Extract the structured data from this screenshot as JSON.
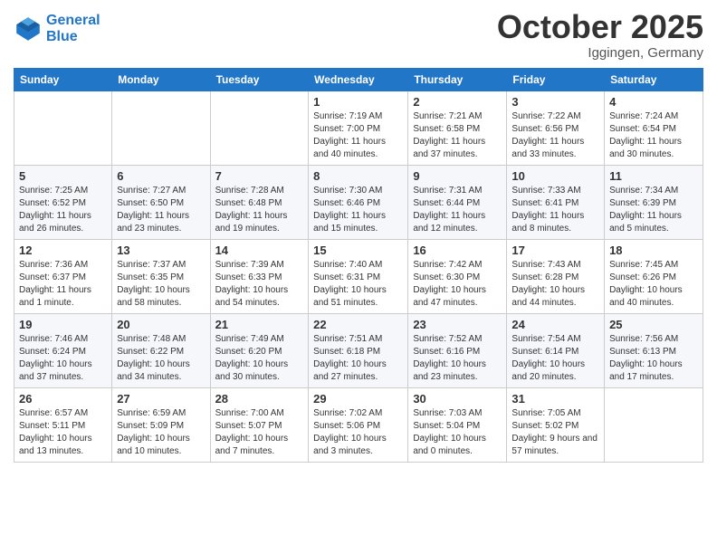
{
  "header": {
    "logo_line1": "General",
    "logo_line2": "Blue",
    "month": "October 2025",
    "location": "Iggingen, Germany"
  },
  "weekdays": [
    "Sunday",
    "Monday",
    "Tuesday",
    "Wednesday",
    "Thursday",
    "Friday",
    "Saturday"
  ],
  "weeks": [
    [
      {
        "day": "",
        "info": ""
      },
      {
        "day": "",
        "info": ""
      },
      {
        "day": "",
        "info": ""
      },
      {
        "day": "1",
        "info": "Sunrise: 7:19 AM\nSunset: 7:00 PM\nDaylight: 11 hours and 40 minutes."
      },
      {
        "day": "2",
        "info": "Sunrise: 7:21 AM\nSunset: 6:58 PM\nDaylight: 11 hours and 37 minutes."
      },
      {
        "day": "3",
        "info": "Sunrise: 7:22 AM\nSunset: 6:56 PM\nDaylight: 11 hours and 33 minutes."
      },
      {
        "day": "4",
        "info": "Sunrise: 7:24 AM\nSunset: 6:54 PM\nDaylight: 11 hours and 30 minutes."
      }
    ],
    [
      {
        "day": "5",
        "info": "Sunrise: 7:25 AM\nSunset: 6:52 PM\nDaylight: 11 hours and 26 minutes."
      },
      {
        "day": "6",
        "info": "Sunrise: 7:27 AM\nSunset: 6:50 PM\nDaylight: 11 hours and 23 minutes."
      },
      {
        "day": "7",
        "info": "Sunrise: 7:28 AM\nSunset: 6:48 PM\nDaylight: 11 hours and 19 minutes."
      },
      {
        "day": "8",
        "info": "Sunrise: 7:30 AM\nSunset: 6:46 PM\nDaylight: 11 hours and 15 minutes."
      },
      {
        "day": "9",
        "info": "Sunrise: 7:31 AM\nSunset: 6:44 PM\nDaylight: 11 hours and 12 minutes."
      },
      {
        "day": "10",
        "info": "Sunrise: 7:33 AM\nSunset: 6:41 PM\nDaylight: 11 hours and 8 minutes."
      },
      {
        "day": "11",
        "info": "Sunrise: 7:34 AM\nSunset: 6:39 PM\nDaylight: 11 hours and 5 minutes."
      }
    ],
    [
      {
        "day": "12",
        "info": "Sunrise: 7:36 AM\nSunset: 6:37 PM\nDaylight: 11 hours and 1 minute."
      },
      {
        "day": "13",
        "info": "Sunrise: 7:37 AM\nSunset: 6:35 PM\nDaylight: 10 hours and 58 minutes."
      },
      {
        "day": "14",
        "info": "Sunrise: 7:39 AM\nSunset: 6:33 PM\nDaylight: 10 hours and 54 minutes."
      },
      {
        "day": "15",
        "info": "Sunrise: 7:40 AM\nSunset: 6:31 PM\nDaylight: 10 hours and 51 minutes."
      },
      {
        "day": "16",
        "info": "Sunrise: 7:42 AM\nSunset: 6:30 PM\nDaylight: 10 hours and 47 minutes."
      },
      {
        "day": "17",
        "info": "Sunrise: 7:43 AM\nSunset: 6:28 PM\nDaylight: 10 hours and 44 minutes."
      },
      {
        "day": "18",
        "info": "Sunrise: 7:45 AM\nSunset: 6:26 PM\nDaylight: 10 hours and 40 minutes."
      }
    ],
    [
      {
        "day": "19",
        "info": "Sunrise: 7:46 AM\nSunset: 6:24 PM\nDaylight: 10 hours and 37 minutes."
      },
      {
        "day": "20",
        "info": "Sunrise: 7:48 AM\nSunset: 6:22 PM\nDaylight: 10 hours and 34 minutes."
      },
      {
        "day": "21",
        "info": "Sunrise: 7:49 AM\nSunset: 6:20 PM\nDaylight: 10 hours and 30 minutes."
      },
      {
        "day": "22",
        "info": "Sunrise: 7:51 AM\nSunset: 6:18 PM\nDaylight: 10 hours and 27 minutes."
      },
      {
        "day": "23",
        "info": "Sunrise: 7:52 AM\nSunset: 6:16 PM\nDaylight: 10 hours and 23 minutes."
      },
      {
        "day": "24",
        "info": "Sunrise: 7:54 AM\nSunset: 6:14 PM\nDaylight: 10 hours and 20 minutes."
      },
      {
        "day": "25",
        "info": "Sunrise: 7:56 AM\nSunset: 6:13 PM\nDaylight: 10 hours and 17 minutes."
      }
    ],
    [
      {
        "day": "26",
        "info": "Sunrise: 6:57 AM\nSunset: 5:11 PM\nDaylight: 10 hours and 13 minutes."
      },
      {
        "day": "27",
        "info": "Sunrise: 6:59 AM\nSunset: 5:09 PM\nDaylight: 10 hours and 10 minutes."
      },
      {
        "day": "28",
        "info": "Sunrise: 7:00 AM\nSunset: 5:07 PM\nDaylight: 10 hours and 7 minutes."
      },
      {
        "day": "29",
        "info": "Sunrise: 7:02 AM\nSunset: 5:06 PM\nDaylight: 10 hours and 3 minutes."
      },
      {
        "day": "30",
        "info": "Sunrise: 7:03 AM\nSunset: 5:04 PM\nDaylight: 10 hours and 0 minutes."
      },
      {
        "day": "31",
        "info": "Sunrise: 7:05 AM\nSunset: 5:02 PM\nDaylight: 9 hours and 57 minutes."
      },
      {
        "day": "",
        "info": ""
      }
    ]
  ]
}
